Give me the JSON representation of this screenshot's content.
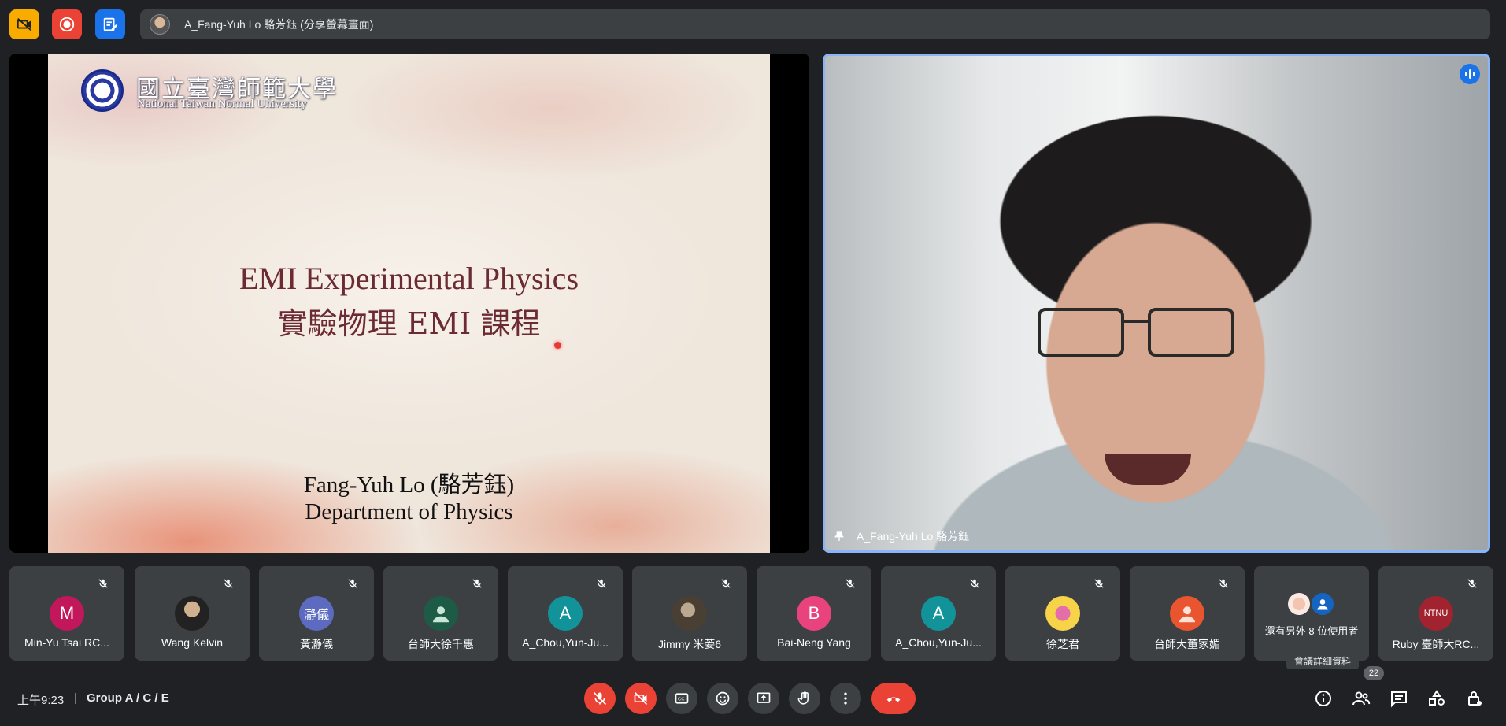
{
  "meeting": {
    "presenter_label": "A_Fang-Yuh Lo 駱芳鈺 (分享螢幕畫面)",
    "time": "上午9:23",
    "separator": "|",
    "meeting_name": "Group A / C / E"
  },
  "slide": {
    "university_zh": "國立臺灣師範大學",
    "university_en": "National Taiwan Normal University",
    "title_en": "EMI Experimental Physics",
    "title_zh": "實驗物理 EMI 課程",
    "presenter": "Fang-Yuh Lo (駱芳鈺)",
    "department": "Department of Physics"
  },
  "speaker": {
    "name": "A_Fang-Yuh Lo 駱芳鈺"
  },
  "participants": [
    {
      "name": "Min-Yu Tsai RC...",
      "initial": "M",
      "color": "#c2185b",
      "kind": "letter"
    },
    {
      "name": "Wang Kelvin",
      "initial": "",
      "kind": "photo"
    },
    {
      "name": "黃瀞儀",
      "initial": "瀞儀",
      "color": "#5c6bc0",
      "kind": "letter"
    },
    {
      "name": "台師大徐千惠",
      "initial": "",
      "kind": "person"
    },
    {
      "name": "A_Chou,Yun-Ju...",
      "initial": "A",
      "color": "#12939a",
      "kind": "letter"
    },
    {
      "name": "Jimmy 米荌6",
      "initial": "",
      "kind": "vintage"
    },
    {
      "name": "Bai-Neng Yang",
      "initial": "B",
      "color": "#e8437c",
      "kind": "letter"
    },
    {
      "name": "A_Chou,Yun-Ju...",
      "initial": "A",
      "color": "#12939a",
      "kind": "letter"
    },
    {
      "name": "徐芝君",
      "initial": "",
      "kind": "flower"
    },
    {
      "name": "台師大董家媚",
      "initial": "",
      "kind": "orange"
    },
    {
      "name": "Ruby 臺師大RC...",
      "initial": "NTNU",
      "kind": "ruby"
    }
  ],
  "more_participants": {
    "label": "還有另外 8 位使用者"
  },
  "tooltip": "會議詳細資料",
  "people_count": "22",
  "icons": {
    "top": [
      "no-camera-icon",
      "record-icon",
      "note-icon"
    ],
    "controls": [
      "mic-off-icon",
      "camera-off-icon",
      "captions-icon",
      "emoji-icon",
      "present-icon",
      "raise-hand-icon",
      "more-options-icon",
      "end-call-icon"
    ],
    "right": [
      "info-icon",
      "people-icon",
      "chat-icon",
      "activities-icon",
      "host-controls-icon"
    ]
  },
  "colors": {
    "background": "#202124",
    "tile": "#3c4043",
    "accent_blue": "#8ab4f8",
    "red": "#ea4335",
    "yellow": "#f9ab00",
    "google_blue": "#1a73e8"
  }
}
